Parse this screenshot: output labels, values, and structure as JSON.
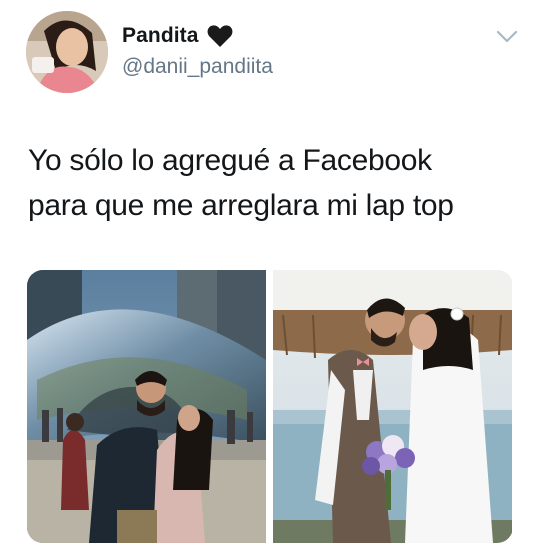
{
  "user": {
    "display_name": "Pandita",
    "name_emoji": "black-heart-icon",
    "handle": "@danii_pandiita",
    "avatar": "avatar-photo"
  },
  "menu": {
    "icon": "chevron-down-icon"
  },
  "tweet": {
    "text_lines": [
      "Yo sólo lo agregué a Facebook",
      "para que me arreglara mi lap top"
    ]
  },
  "media": {
    "photos": [
      {
        "name": "photo-couple-cloud-gate"
      },
      {
        "name": "photo-wedding-kiss"
      }
    ]
  },
  "colors": {
    "text_primary": "#14171a",
    "text_secondary": "#657786",
    "caret": "#aab8c2"
  }
}
